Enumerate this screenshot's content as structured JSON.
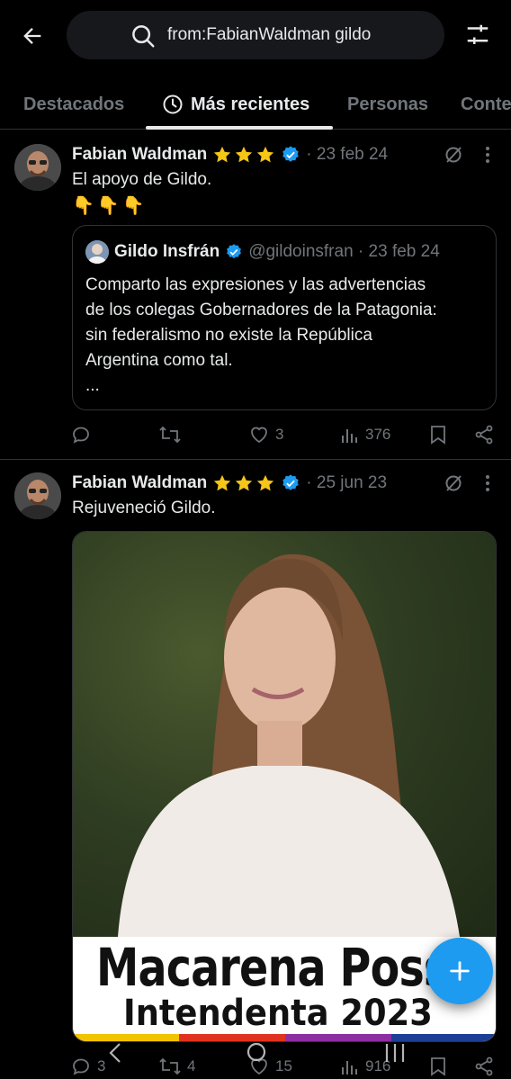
{
  "search": {
    "query": "from:FabianWaldman gildo"
  },
  "tabs": [
    {
      "label": "Destacados"
    },
    {
      "label": "Más recientes"
    },
    {
      "label": "Personas"
    },
    {
      "label": "Conte"
    }
  ],
  "tweets": [
    {
      "author": "Fabian Waldman",
      "meta": "· 23 feb 24",
      "text": "El apoyo de Gildo.",
      "emojis": [
        "👇",
        "👇",
        "👇"
      ],
      "quote": {
        "author": "Gildo Insfrán",
        "meta": "@gildoinsfran · 23 feb 24",
        "lines": [
          "Comparto las expresiones y las advertencias",
          "de los colegas Gobernadores de la Patagonia:",
          "sin federalismo no existe la República",
          "Argentina como tal.",
          "..."
        ]
      },
      "stats": {
        "replies": "",
        "reposts": "",
        "likes": "3",
        "views": "376"
      }
    },
    {
      "author": "Fabian Waldman",
      "meta": "· 25 jun 23",
      "text": "Rejuveneció Gildo.",
      "media": {
        "banner_name": "Macarena Poss",
        "banner_sub": "Intendenta 2023"
      },
      "stats": {
        "replies": "3",
        "reposts": "4",
        "likes": "15",
        "views": "916"
      }
    }
  ],
  "colors": {
    "accent": "#1d9bf0",
    "star": "#f5c518",
    "muted": "#71767b",
    "background": "#000000"
  },
  "icons": [
    "back-arrow-icon",
    "search-icon",
    "filter-icon",
    "clock-icon",
    "star-icon",
    "verified-icon",
    "grok-icon",
    "more-icon",
    "reply-icon",
    "repost-icon",
    "like-icon",
    "views-icon",
    "bookmark-icon",
    "share-icon",
    "plus-icon"
  ]
}
